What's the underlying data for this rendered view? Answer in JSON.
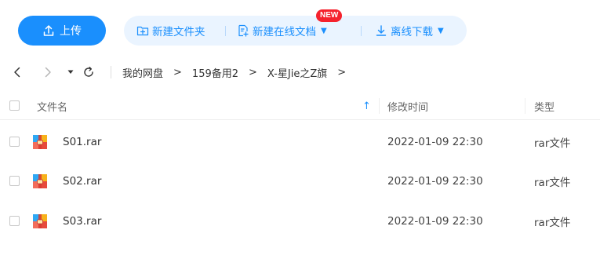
{
  "toolbar": {
    "upload_label": "上传",
    "new_folder_label": "新建文件夹",
    "new_online_doc_label": "新建在线文档",
    "new_badge": "NEW",
    "offline_download_label": "离线下载",
    "caret": "▼"
  },
  "breadcrumb": {
    "items": [
      "我的网盘",
      "159备用2",
      "X-星Jie之Z旗"
    ],
    "separator": ">"
  },
  "table": {
    "columns": {
      "name": "文件名",
      "sort_indicator": "↑",
      "modified": "修改时间",
      "type": "类型"
    },
    "rows": [
      {
        "name": "S01.rar",
        "modified": "2022-01-09 22:30",
        "type": "rar文件"
      },
      {
        "name": "S02.rar",
        "modified": "2022-01-09 22:30",
        "type": "rar文件"
      },
      {
        "name": "S03.rar",
        "modified": "2022-01-09 22:30",
        "type": "rar文件"
      }
    ]
  },
  "colors": {
    "accent": "#1a8ffd",
    "pill_bg": "#eaf4ff",
    "badge": "#f5222d"
  },
  "icons": {
    "upload": "upload-icon",
    "new_folder": "new-folder-icon",
    "new_doc": "new-doc-icon",
    "offline_download": "download-icon",
    "back": "chevron-left-icon",
    "forward": "chevron-right-icon",
    "history": "dropdown-icon",
    "refresh": "refresh-icon",
    "file": "rar-archive-icon"
  }
}
